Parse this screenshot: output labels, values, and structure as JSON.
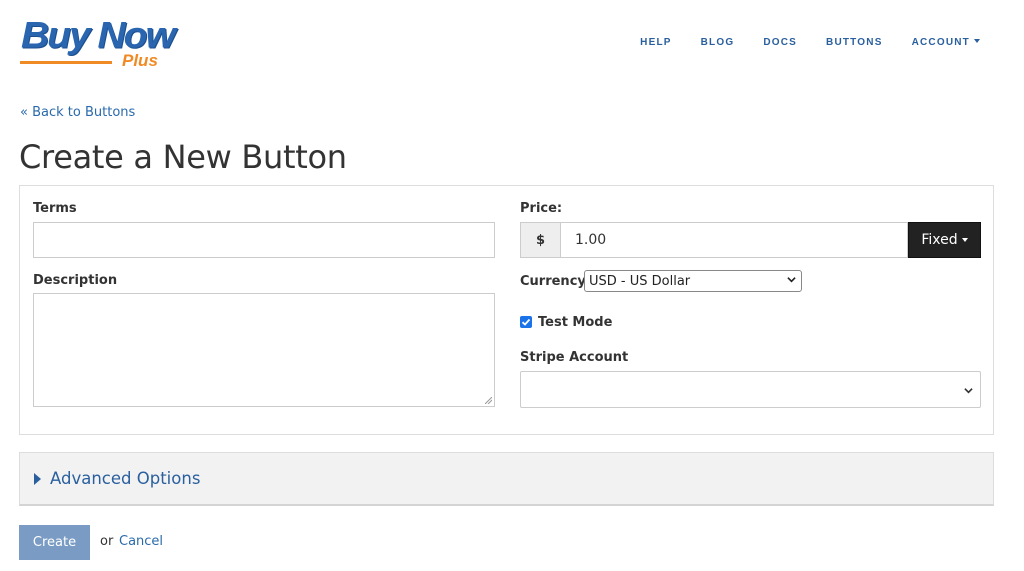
{
  "logo": {
    "main": "Buy Now",
    "sub": "Plus"
  },
  "nav": {
    "help": "HELP",
    "blog": "BLOG",
    "docs": "DOCS",
    "buttons": "BUTTONS",
    "account": "ACCOUNT"
  },
  "back_link": "« Back to Buttons",
  "page_title": "Create a New Button",
  "form": {
    "terms_label": "Terms",
    "terms_value": "",
    "description_label": "Description",
    "description_value": "",
    "price_label": "Price:",
    "price_prefix": "$",
    "price_value": "1.00",
    "price_mode": "Fixed",
    "currency_label": "Currency",
    "currency_value": "USD - US Dollar",
    "test_mode_label": "Test Mode",
    "test_mode_checked": true,
    "stripe_account_label": "Stripe Account",
    "stripe_account_value": ""
  },
  "advanced_options_label": "Advanced Options",
  "actions": {
    "create": "Create",
    "or": "or",
    "cancel": "Cancel"
  },
  "colors": {
    "brand_blue": "#2a66b0",
    "brand_orange": "#f08a24",
    "link": "#2a6aab",
    "create_button": "#7a9cc4",
    "fixed_button": "#222222"
  }
}
